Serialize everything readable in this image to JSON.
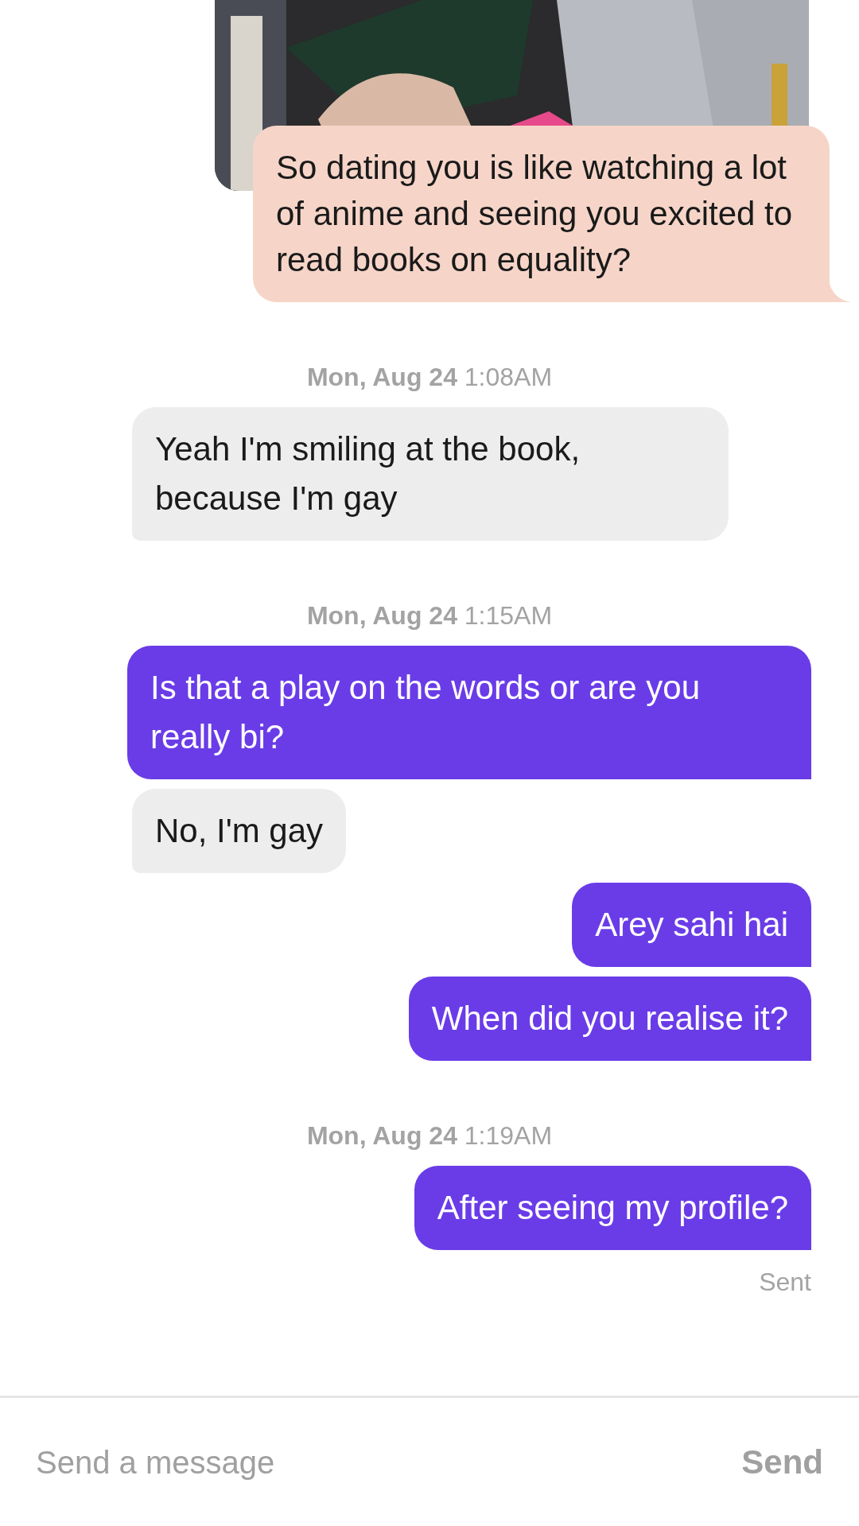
{
  "messages": [
    {
      "kind": "photo_reply",
      "text": "So dating you is like watching a lot of anime and seeing you excited to read books on equality?"
    },
    {
      "kind": "timestamp",
      "date": "Mon, Aug 24",
      "time": "1:08AM"
    },
    {
      "kind": "received",
      "text": "Yeah I'm smiling at the book, because I'm gay"
    },
    {
      "kind": "timestamp",
      "date": "Mon, Aug 24",
      "time": "1:15AM"
    },
    {
      "kind": "sent",
      "text": "Is that a play on the words or are you really bi?"
    },
    {
      "kind": "received",
      "text": "No, I'm gay"
    },
    {
      "kind": "sent",
      "text": "Arey sahi hai"
    },
    {
      "kind": "sent",
      "text": "When did you realise it?"
    },
    {
      "kind": "timestamp",
      "date": "Mon, Aug 24",
      "time": "1:19AM"
    },
    {
      "kind": "sent",
      "text": "After seeing my profile?"
    }
  ],
  "status": "Sent",
  "composer": {
    "placeholder": "Send a message",
    "button": "Send"
  }
}
